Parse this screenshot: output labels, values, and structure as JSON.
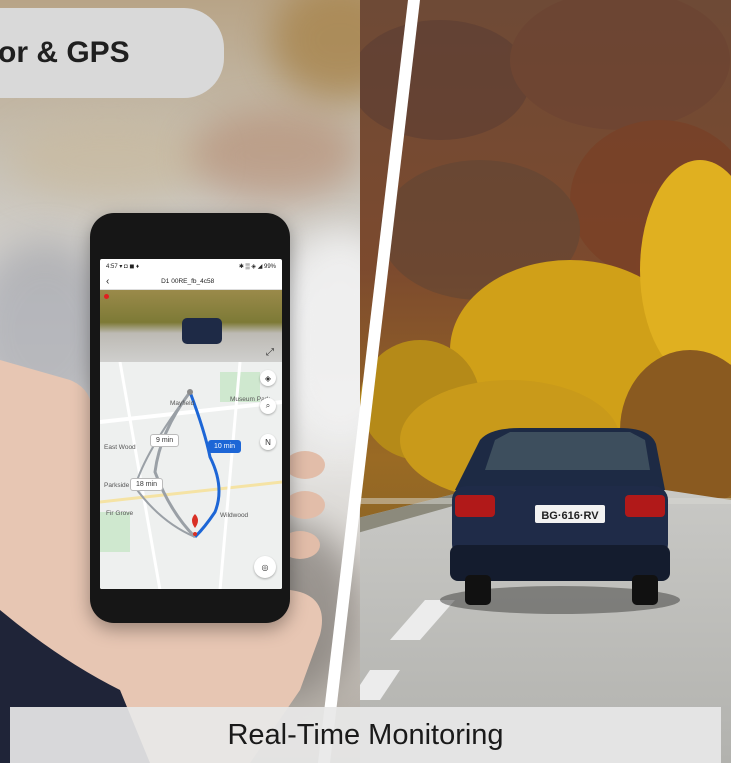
{
  "feature_label": "or & GPS",
  "caption": "Real-Time Monitoring",
  "phone": {
    "status_bar": {
      "left": "4:57 ▾ ◘ ◼ ♦",
      "right": "✱ ▒ ◈ ◢ 99%"
    },
    "nav_bar": {
      "back": "‹",
      "title": "D1 00RE_fb_4c58"
    },
    "video": {
      "recording_dot_color": "#e02020"
    },
    "map": {
      "labels": [
        "Mayfield",
        "Museum Park",
        "East Wood",
        "Parkside",
        "Fir Grove",
        "Wildwood"
      ],
      "eta_alt": "9 min",
      "eta_main": "10 min",
      "eta_alt2": "18 min",
      "route_color": "#1d66d6"
    }
  },
  "plate": "BG·616·RV",
  "colors": {
    "label_bg": "#d9d9d9",
    "caption_bg": "#e8e8e8"
  }
}
